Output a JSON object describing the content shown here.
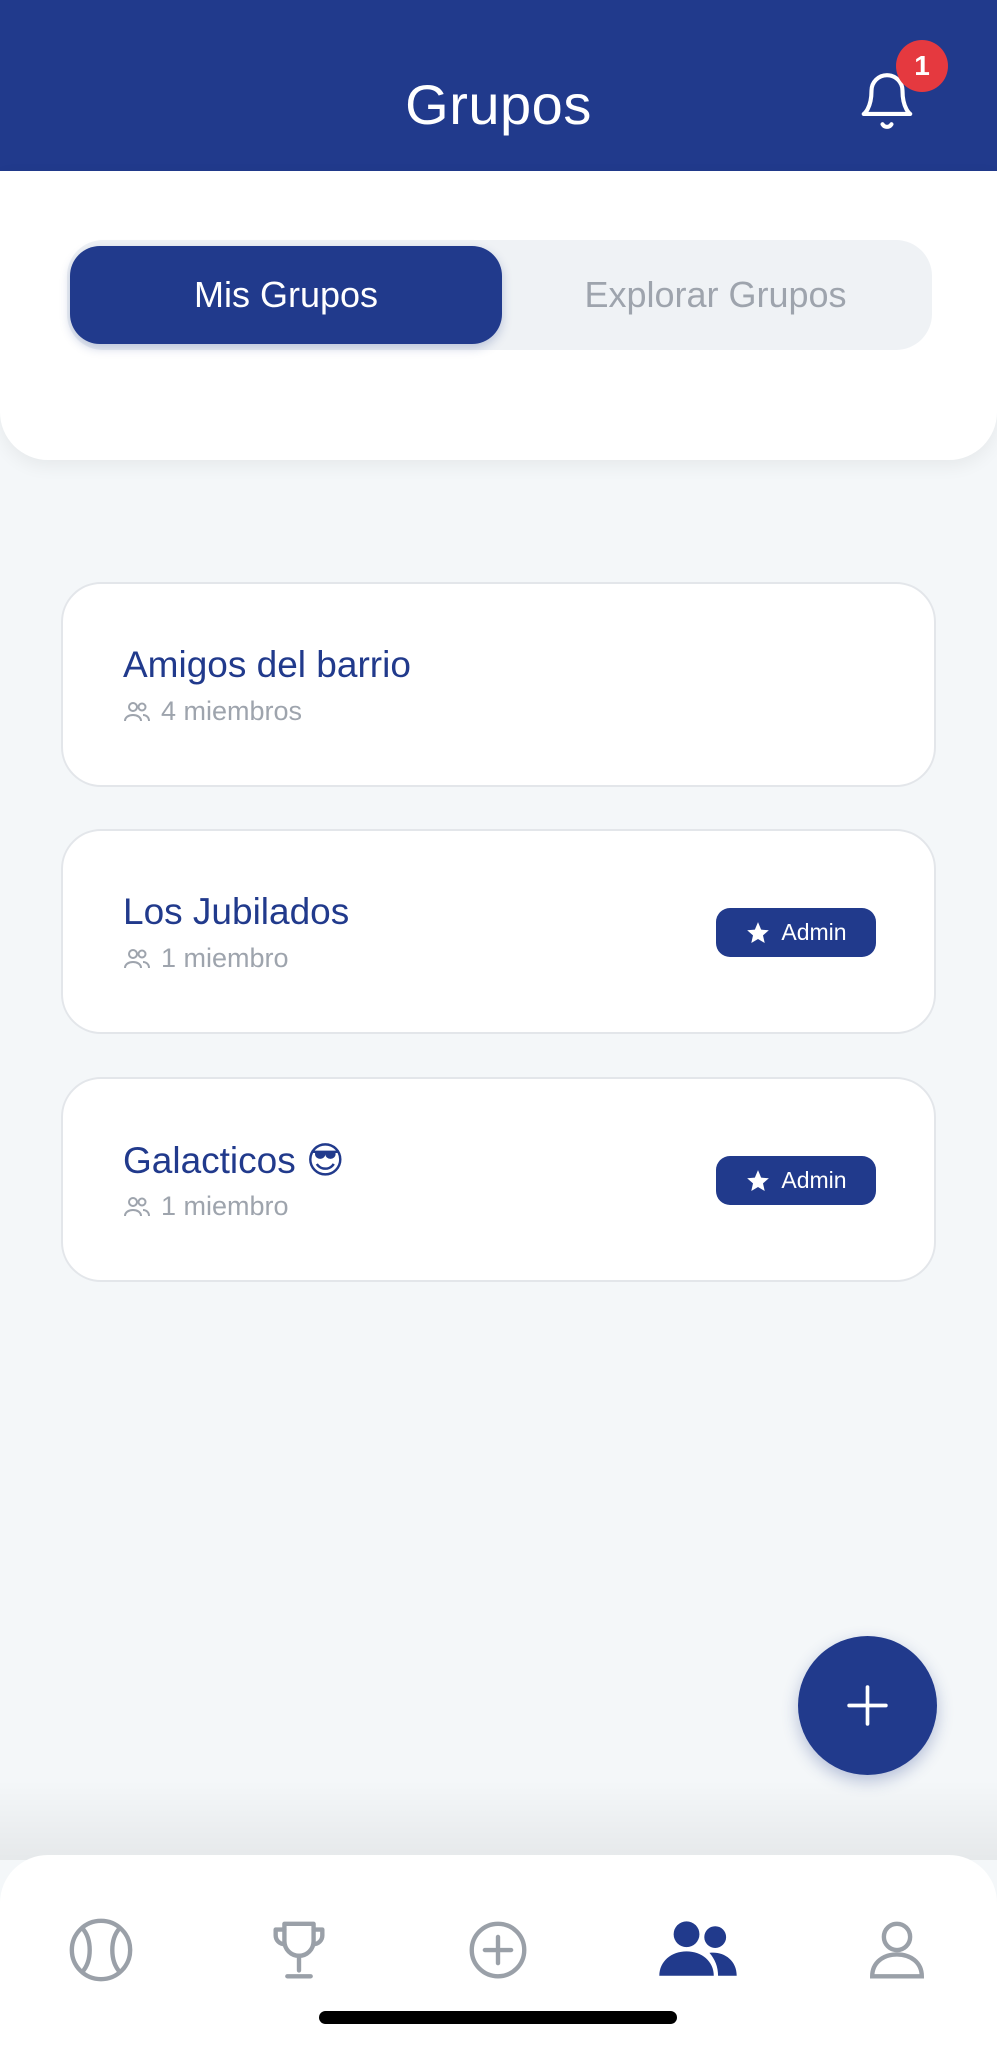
{
  "header": {
    "title": "Grupos",
    "notifications_count": "1",
    "bell_icon": "bell-icon"
  },
  "tabs": [
    {
      "label": "Mis Grupos",
      "active": true
    },
    {
      "label": "Explorar Grupos",
      "active": false
    }
  ],
  "groups": [
    {
      "name": "Amigos del barrio",
      "members": "4 miembros",
      "admin": false
    },
    {
      "name": "Los Jubilados",
      "members": "1 miembro",
      "admin": true,
      "admin_label": "Admin"
    },
    {
      "name": "Galacticos 😎",
      "members": "1 miembro",
      "admin": true,
      "admin_label": "Admin"
    }
  ],
  "fab": {
    "icon": "plus-icon"
  },
  "bottom_nav": [
    {
      "icon": "tennis-ball-icon",
      "active": false
    },
    {
      "icon": "trophy-icon",
      "active": false
    },
    {
      "icon": "add-circle-icon",
      "active": false
    },
    {
      "icon": "groups-icon",
      "active": true
    },
    {
      "icon": "profile-icon",
      "active": false
    }
  ],
  "colors": {
    "primary": "#213a8c",
    "badge": "#e5393f",
    "muted_text": "#9ea4ad",
    "background": "#f4f7f9",
    "inactive_icon": "#9aa0a8"
  }
}
